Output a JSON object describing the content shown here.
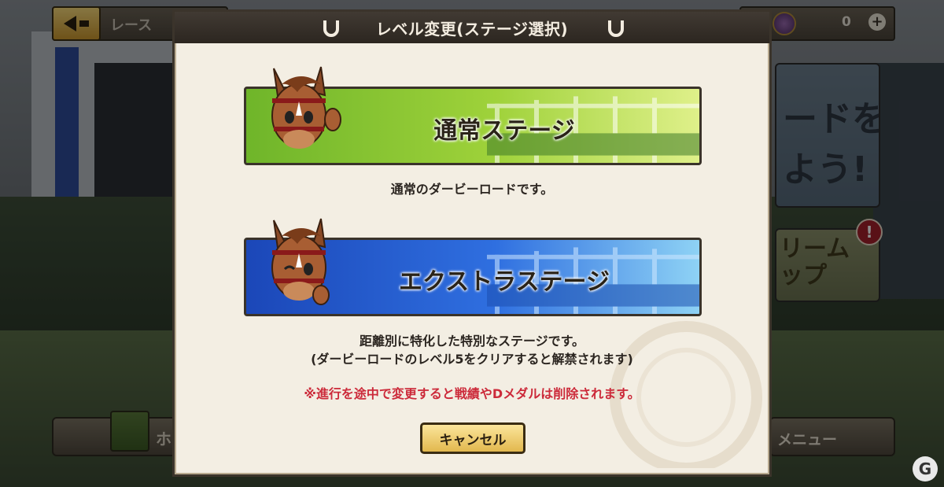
{
  "background": {
    "race_title": "レース",
    "currency_count": "0",
    "promo_text": "ードを\nよう!",
    "dream_text": "リーム\nップ",
    "alert": "!",
    "bottom_left_label": "ホ",
    "bottom_right_label": "メニュー"
  },
  "dialog": {
    "title": "レベル変更(ステージ選択)",
    "normal_stage": {
      "label": "通常ステージ",
      "description": "通常のダービーロードです。"
    },
    "extra_stage": {
      "label": "エクストラステージ",
      "description_line1": "距離別に特化した特別なステージです。",
      "description_line2": "(ダービーロードのレベル5をクリアすると解禁されます)"
    },
    "warning": "※進行を途中で変更すると戦績やDメダルは削除されます。",
    "cancel_label": "キャンセル"
  },
  "icons": {
    "back": "back-arrow-icon",
    "plus": "plus-icon",
    "horseshoe": "horseshoe-icon",
    "mascot": "horse-mascot-icon",
    "watermark": "G"
  },
  "colors": {
    "normal_stage": "#6fb52a",
    "extra_stage": "#2f6fe0",
    "warning": "#cc2a3a",
    "cancel": "#e2b84e"
  }
}
